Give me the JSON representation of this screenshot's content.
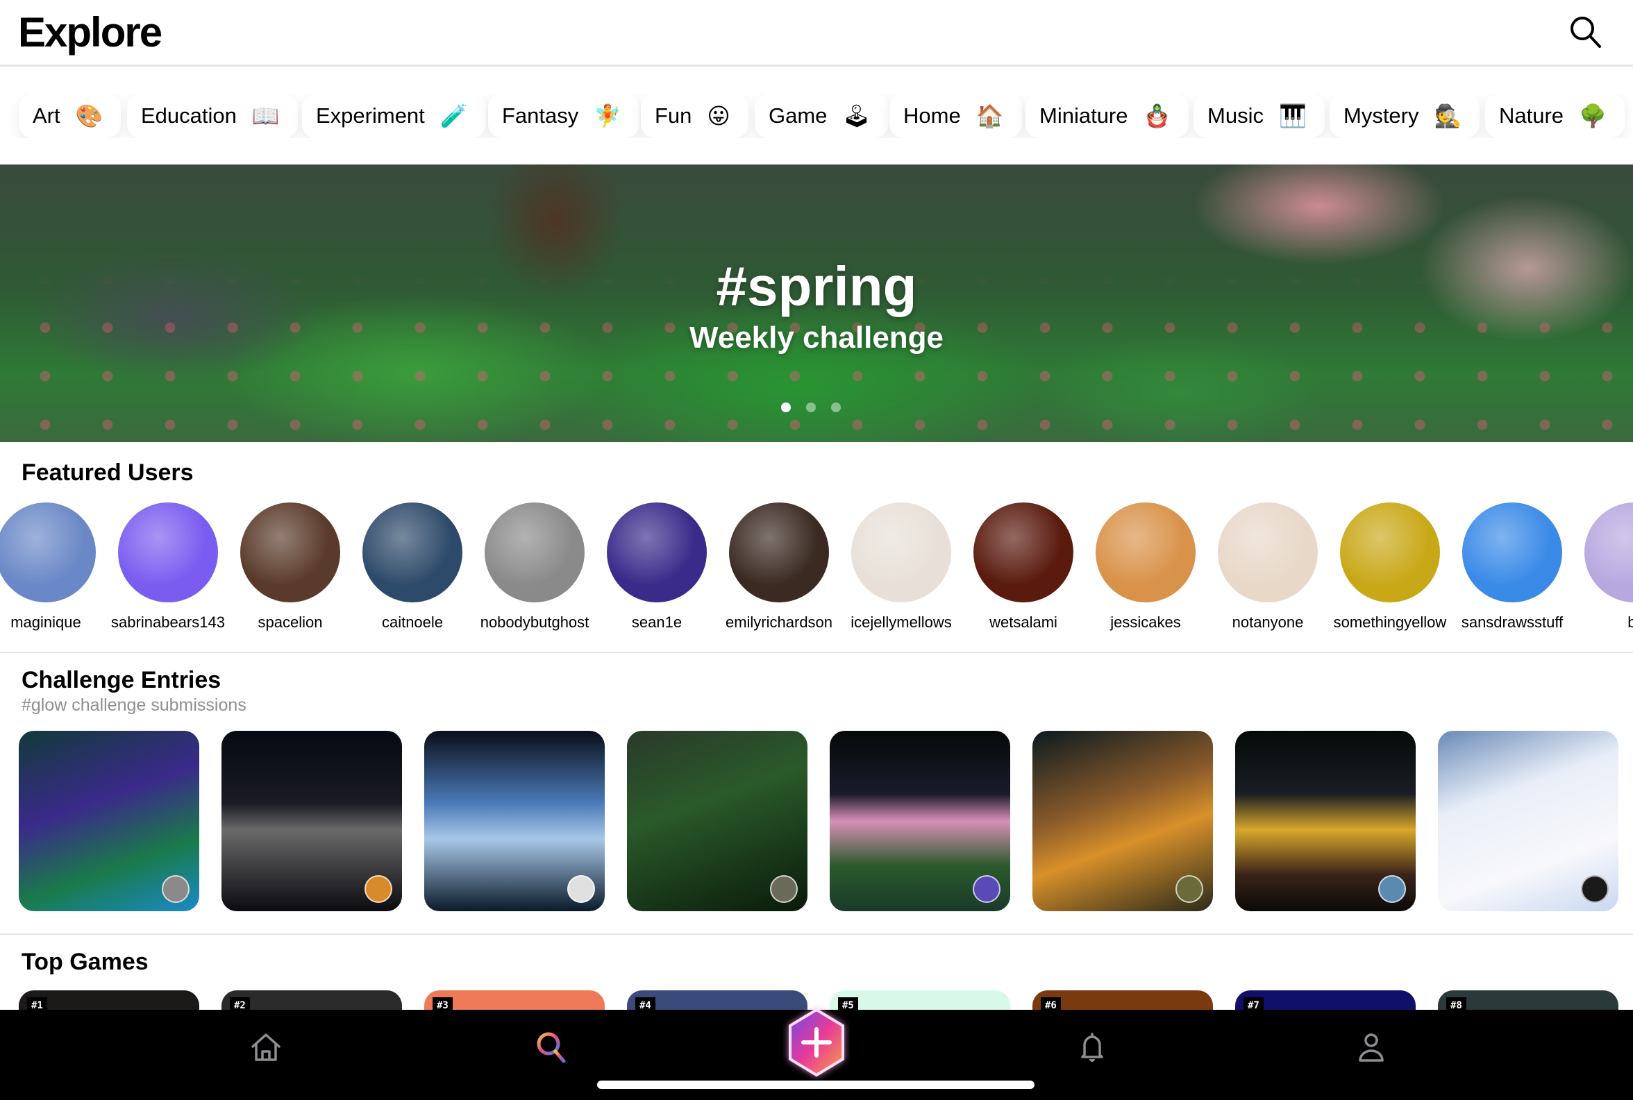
{
  "header": {
    "title": "Explore",
    "search_icon": "search-icon"
  },
  "categories": [
    {
      "label": "Art",
      "emoji": "🎨"
    },
    {
      "label": "Education",
      "emoji": "📖"
    },
    {
      "label": "Experiment",
      "emoji": "🧪"
    },
    {
      "label": "Fantasy",
      "emoji": "🧚"
    },
    {
      "label": "Fun",
      "emoji": "😛"
    },
    {
      "label": "Game",
      "emoji": "🕹"
    },
    {
      "label": "Home",
      "emoji": "🏠"
    },
    {
      "label": "Miniature",
      "emoji": "🪆"
    },
    {
      "label": "Music",
      "emoji": "🎹"
    },
    {
      "label": "Mystery",
      "emoji": "🕵"
    },
    {
      "label": "Nature",
      "emoji": "🌳"
    }
  ],
  "banner": {
    "title": "#spring",
    "subtitle": "Weekly challenge",
    "page_count": 3,
    "active_page": 1
  },
  "featured_users": {
    "title": "Featured Users",
    "users": [
      {
        "name": "maginique",
        "color": "#6a88c7"
      },
      {
        "name": "sabrinabears143",
        "color": "#7a5cf0"
      },
      {
        "name": "spacelion",
        "color": "#5a3a2a"
      },
      {
        "name": "caitnoele",
        "color": "#2e4a6a"
      },
      {
        "name": "nobodybutghost",
        "color": "#8a8a8a"
      },
      {
        "name": "sean1e",
        "color": "#3a2a8a"
      },
      {
        "name": "emilyrichardson",
        "color": "#3a2a22"
      },
      {
        "name": "icejellymellows",
        "color": "#e8e0d8"
      },
      {
        "name": "wetsalami",
        "color": "#5a1a0e"
      },
      {
        "name": "jessicakes",
        "color": "#d9924a"
      },
      {
        "name": "notanyone",
        "color": "#e8d8c8"
      },
      {
        "name": "somethingyellow",
        "color": "#c9a818"
      },
      {
        "name": "sansdrawsstuff",
        "color": "#3a8ae8"
      },
      {
        "name": "br",
        "color": "#b8a8e0"
      }
    ]
  },
  "challenge_entries": {
    "title": "Challenge Entries",
    "subtitle": "#glow challenge submissions",
    "entries": [
      {
        "bg": "linear-gradient(160deg,#123a3a 0%,#3a2a8a 40%,#1a7a4a 70%,#1a8ac8 100%)",
        "avatar": "#8a8a8a"
      },
      {
        "bg": "linear-gradient(180deg,#050a12 0%,#1a1a24 40%,#6a6a6a 55%,#0a0a10 100%)",
        "avatar": "#d98a2a"
      },
      {
        "bg": "linear-gradient(180deg,#0a0e18 0%,#4a7ab8 40%,#a8c8e8 60%,#0a1a2a 100%)",
        "avatar": "#e0e0e0"
      },
      {
        "bg": "linear-gradient(160deg,#2a3a2a 0%,#2a5a2a 40%,#1a3a1a 70%,#0a1a0a 100%)",
        "avatar": "#6a6a5a"
      },
      {
        "bg": "linear-gradient(180deg,#050a08 0%,#1a1a2a 35%,#d890b8 50%,#2a5a2a 75%,#1a3a2a 100%)",
        "avatar": "#5a4ab8"
      },
      {
        "bg": "linear-gradient(160deg,#0a1a20 0%,#8a5a2a 40%,#d8902a 60%,#2a2a1a 100%)",
        "avatar": "#6a6a3a"
      },
      {
        "bg": "linear-gradient(180deg,#050a08 0%,#1a1e24 35%,#d8a82a 55%,#3a2218 80%,#0a0a08 100%)",
        "avatar": "#5a8ab0"
      },
      {
        "bg": "linear-gradient(160deg,#6a8ab8 0%,#e8eef8 35%,#f8f8fc 70%,#c8d8f0 100%)",
        "avatar": "#1a1a1a"
      }
    ]
  },
  "top_games": {
    "title": "Top Games",
    "games": [
      {
        "rank": "#1",
        "bg": "#1c1a18"
      },
      {
        "rank": "#2",
        "bg": "#2a2a2a"
      },
      {
        "rank": "#3",
        "bg": "#ef7a5a"
      },
      {
        "rank": "#4",
        "bg": "#3a4a7a"
      },
      {
        "rank": "#5",
        "bg": "#d8f8e8"
      },
      {
        "rank": "#6",
        "bg": "#7a3a10"
      },
      {
        "rank": "#7",
        "bg": "#10106a"
      },
      {
        "rank": "#8",
        "bg": "#2a3a3a"
      }
    ]
  },
  "tab_bar": {
    "items": [
      {
        "name": "home",
        "icon": "home-icon",
        "active": false
      },
      {
        "name": "explore",
        "icon": "search-icon",
        "active": true
      },
      {
        "name": "create",
        "icon": "plus-icon",
        "active": false
      },
      {
        "name": "notifications",
        "icon": "bell-icon",
        "active": false
      },
      {
        "name": "profile",
        "icon": "person-icon",
        "active": false
      }
    ]
  },
  "colors": {
    "tab_inactive": "#8e8e93",
    "tab_bar_bg": "#000000",
    "subtitle_gray": "#8e8e93"
  }
}
